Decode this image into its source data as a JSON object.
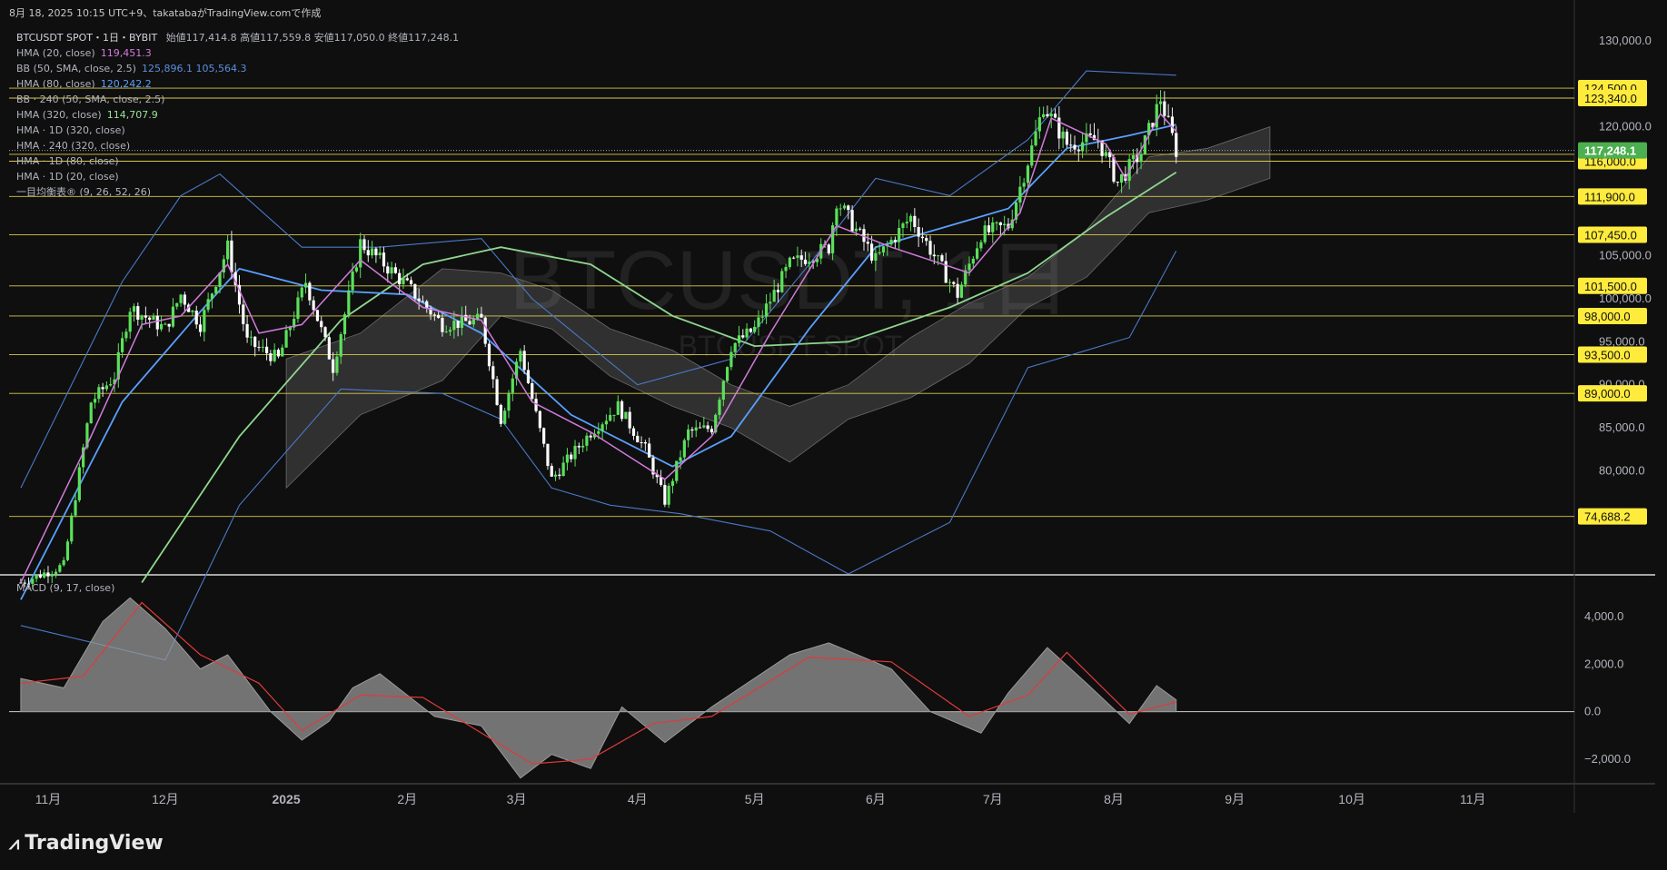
{
  "header": {
    "caption": "8月 18, 2025 10:15 UTC+9、takatabaがTradingView.comで作成",
    "symbol": "BTCUSDT SPOT・1日・BYBIT",
    "ohlc": "始値117,414.8 高値117,559.8 安値117,050.0 終値117,248.1"
  },
  "indicators": [
    {
      "label": "HMA (20, close)",
      "value": "119,451.3",
      "color": "#d17bdb"
    },
    {
      "label": "BB (50, SMA, close, 2.5)",
      "value": "125,896.1  105,564.3",
      "color": "#5b8fde"
    },
    {
      "label": "HMA (80, close)",
      "value": "120,242.2",
      "color": "#5aa0ff"
    },
    {
      "label": "BB · 240 (50, SMA, close, 2.5)",
      "value": "",
      "color": "#b2b5be"
    },
    {
      "label": "HMA (320, close)",
      "value": "114,707.9",
      "color": "#9be39b"
    },
    {
      "label": "HMA · 1D (320, close)",
      "value": "",
      "color": "#b2b5be"
    },
    {
      "label": "HMA · 240 (320, close)",
      "value": "",
      "color": "#b2b5be"
    },
    {
      "label": "HMA · 1D (80, close)",
      "value": "",
      "color": "#b2b5be"
    },
    {
      "label": "HMA · 1D (20, close)",
      "value": "",
      "color": "#b2b5be"
    },
    {
      "label": "一目均衡表® (9, 26, 52, 26)",
      "value": "",
      "color": "#b2b5be"
    }
  ],
  "watermark": {
    "big": "BTCUSDT, 1日",
    "small": "BTCUSDT SPOT"
  },
  "macd_label": "MACD (9, 17, close)",
  "brand": "TradingView",
  "chart_data": [
    {
      "type": "candlestick",
      "title": "BTCUSDT SPOT・1日・BYBIT",
      "ylim": [
        68000,
        132000
      ],
      "y_ticks": [
        "130,000.0",
        "120,000.0",
        "105,000.0",
        "100,000.0",
        "95,000.0",
        "90,000.0",
        "85,000.0",
        "80,000.0"
      ],
      "x_ticks": [
        "11月",
        "12月",
        "2025",
        "2月",
        "3月",
        "4月",
        "5月",
        "6月",
        "7月",
        "8月",
        "9月",
        "10月",
        "11月"
      ],
      "horizontal_levels": [
        124500,
        123340,
        116800,
        116000,
        111900,
        107450,
        101500,
        98000,
        93500,
        89000,
        74688.2
      ],
      "level_labels": [
        "124,500.0",
        "123,340.0",
        "116,800.0",
        "116,000.0",
        "111,900.0",
        "107,450.0",
        "101,500.0",
        "98,000.0",
        "93,500.0",
        "89,000.0",
        "74,688.2"
      ],
      "last_price": 117248.1,
      "last_price_label": "117,248.1",
      "price_path": [
        [
          "2024-10-25",
          67000
        ],
        [
          "2024-11-05",
          69000
        ],
        [
          "2024-11-12",
          88000
        ],
        [
          "2024-11-18",
          91000
        ],
        [
          "2024-11-22",
          99000
        ],
        [
          "2024-12-01",
          96500
        ],
        [
          "2024-12-05",
          100500
        ],
        [
          "2024-12-10",
          97000
        ],
        [
          "2024-12-17",
          106000
        ],
        [
          "2024-12-22",
          95000
        ],
        [
          "2024-12-30",
          93000
        ],
        [
          "2025-01-06",
          102000
        ],
        [
          "2025-01-13",
          92000
        ],
        [
          "2025-01-20",
          106500
        ],
        [
          "2025-01-25",
          104500
        ],
        [
          "2025-02-01",
          101500
        ],
        [
          "2025-02-10",
          97000
        ],
        [
          "2025-02-20",
          97500
        ],
        [
          "2025-02-25",
          86000
        ],
        [
          "2025-03-02",
          94000
        ],
        [
          "2025-03-10",
          79000
        ],
        [
          "2025-03-20",
          84500
        ],
        [
          "2025-03-27",
          87500
        ],
        [
          "2025-04-03",
          82500
        ],
        [
          "2025-04-08",
          76500
        ],
        [
          "2025-04-14",
          84500
        ],
        [
          "2025-04-20",
          85000
        ],
        [
          "2025-04-25",
          94500
        ],
        [
          "2025-05-01",
          96500
        ],
        [
          "2025-05-10",
          104000
        ],
        [
          "2025-05-20",
          106000
        ],
        [
          "2025-05-22",
          111500
        ],
        [
          "2025-06-01",
          104500
        ],
        [
          "2025-06-10",
          109500
        ],
        [
          "2025-06-22",
          100500
        ],
        [
          "2025-06-28",
          107500
        ],
        [
          "2025-07-05",
          108500
        ],
        [
          "2025-07-11",
          117500
        ],
        [
          "2025-07-14",
          122500
        ],
        [
          "2025-07-20",
          118000
        ],
        [
          "2025-07-28",
          118500
        ],
        [
          "2025-08-02",
          113500
        ],
        [
          "2025-08-08",
          117000
        ],
        [
          "2025-08-13",
          123300
        ],
        [
          "2025-08-17",
          117248.1
        ]
      ],
      "hma20": [
        [
          "2024-10-25",
          67000
        ],
        [
          "2024-11-12",
          84000
        ],
        [
          "2024-11-25",
          97000
        ],
        [
          "2024-12-05",
          98000
        ],
        [
          "2024-12-17",
          104000
        ],
        [
          "2024-12-25",
          96000
        ],
        [
          "2025-01-05",
          97000
        ],
        [
          "2025-01-20",
          104500
        ],
        [
          "2025-02-05",
          99000
        ],
        [
          "2025-02-20",
          97500
        ],
        [
          "2025-03-05",
          88000
        ],
        [
          "2025-03-20",
          84500
        ],
        [
          "2025-04-08",
          79000
        ],
        [
          "2025-04-20",
          84000
        ],
        [
          "2025-05-05",
          96000
        ],
        [
          "2025-05-22",
          108500
        ],
        [
          "2025-06-05",
          106000
        ],
        [
          "2025-06-25",
          103000
        ],
        [
          "2025-07-08",
          110000
        ],
        [
          "2025-07-16",
          121000
        ],
        [
          "2025-07-30",
          118000
        ],
        [
          "2025-08-04",
          114000
        ],
        [
          "2025-08-13",
          121500
        ],
        [
          "2025-08-17",
          119451.3
        ]
      ],
      "hma80": [
        [
          "2024-10-25",
          65000
        ],
        [
          "2024-11-20",
          88000
        ],
        [
          "2024-12-10",
          98500
        ],
        [
          "2024-12-20",
          103500
        ],
        [
          "2025-01-10",
          101000
        ],
        [
          "2025-02-01",
          100500
        ],
        [
          "2025-02-20",
          96000
        ],
        [
          "2025-03-15",
          86500
        ],
        [
          "2025-04-10",
          80500
        ],
        [
          "2025-04-25",
          84000
        ],
        [
          "2025-05-15",
          96500
        ],
        [
          "2025-06-01",
          106000
        ],
        [
          "2025-06-20",
          108500
        ],
        [
          "2025-07-05",
          110500
        ],
        [
          "2025-07-20",
          117500
        ],
        [
          "2025-08-05",
          119000
        ],
        [
          "2025-08-17",
          120242.2
        ]
      ],
      "hma320": [
        [
          "2024-11-25",
          67000
        ],
        [
          "2024-12-20",
          84000
        ],
        [
          "2025-01-15",
          97500
        ],
        [
          "2025-02-05",
          104000
        ],
        [
          "2025-02-25",
          106000
        ],
        [
          "2025-03-20",
          104000
        ],
        [
          "2025-04-10",
          98000
        ],
        [
          "2025-05-01",
          94500
        ],
        [
          "2025-05-25",
          95000
        ],
        [
          "2025-06-20",
          99000
        ],
        [
          "2025-07-10",
          103000
        ],
        [
          "2025-07-30",
          109500
        ],
        [
          "2025-08-17",
          114707.9
        ]
      ],
      "bb_upper": [
        [
          "2024-10-25",
          78000
        ],
        [
          "2024-11-20",
          102000
        ],
        [
          "2024-12-05",
          112000
        ],
        [
          "2024-12-15",
          114500
        ],
        [
          "2025-01-05",
          106000
        ],
        [
          "2025-01-25",
          106000
        ],
        [
          "2025-02-20",
          107000
        ],
        [
          "2025-03-05",
          100000
        ],
        [
          "2025-04-01",
          90000
        ],
        [
          "2025-04-25",
          93000
        ],
        [
          "2025-05-15",
          104000
        ],
        [
          "2025-06-01",
          114000
        ],
        [
          "2025-06-20",
          112000
        ],
        [
          "2025-07-10",
          118500
        ],
        [
          "2025-07-25",
          126500
        ],
        [
          "2025-08-17",
          126000
        ]
      ],
      "bb_lower": [
        [
          "2024-10-25",
          62000
        ],
        [
          "2024-12-01",
          58000
        ],
        [
          "2024-12-20",
          76000
        ],
        [
          "2025-01-15",
          89500
        ],
        [
          "2025-02-10",
          89000
        ],
        [
          "2025-02-25",
          86000
        ],
        [
          "2025-03-10",
          78000
        ],
        [
          "2025-03-25",
          76000
        ],
        [
          "2025-04-12",
          75000
        ],
        [
          "2025-05-05",
          73000
        ],
        [
          "2025-05-25",
          68000
        ],
        [
          "2025-06-20",
          74000
        ],
        [
          "2025-07-10",
          92000
        ],
        [
          "2025-07-25",
          94000
        ],
        [
          "2025-08-05",
          95500
        ],
        [
          "2025-08-17",
          105564.3
        ]
      ]
    },
    {
      "type": "area",
      "title": "MACD (9, 17, close)",
      "ylim": [
        -3000,
        5500
      ],
      "y_ticks": [
        "4,000.0",
        "2,000.0",
        "0.0",
        "−2,000.0"
      ],
      "histogram": [
        [
          "2024-10-25",
          1400
        ],
        [
          "2024-11-05",
          1000
        ],
        [
          "2024-11-15",
          3800
        ],
        [
          "2024-11-22",
          4800
        ],
        [
          "2024-12-01",
          3500
        ],
        [
          "2024-12-10",
          1800
        ],
        [
          "2024-12-17",
          2400
        ],
        [
          "2024-12-28",
          0
        ],
        [
          "2025-01-05",
          -1200
        ],
        [
          "2025-01-12",
          -400
        ],
        [
          "2025-01-18",
          1000
        ],
        [
          "2025-01-25",
          1600
        ],
        [
          "2025-02-08",
          -200
        ],
        [
          "2025-02-20",
          -600
        ],
        [
          "2025-03-02",
          -2800
        ],
        [
          "2025-03-10",
          -1800
        ],
        [
          "2025-03-20",
          -2400
        ],
        [
          "2025-03-28",
          200
        ],
        [
          "2025-04-08",
          -1300
        ],
        [
          "2025-04-20",
          200
        ],
        [
          "2025-05-10",
          2400
        ],
        [
          "2025-05-20",
          2900
        ],
        [
          "2025-06-05",
          1800
        ],
        [
          "2025-06-15",
          0
        ],
        [
          "2025-06-28",
          -900
        ],
        [
          "2025-07-05",
          800
        ],
        [
          "2025-07-15",
          2700
        ],
        [
          "2025-07-25",
          1200
        ],
        [
          "2025-08-05",
          -500
        ],
        [
          "2025-08-12",
          1100
        ],
        [
          "2025-08-17",
          500
        ]
      ],
      "signal": [
        [
          "2024-10-25",
          1200
        ],
        [
          "2024-11-10",
          1500
        ],
        [
          "2024-11-25",
          4600
        ],
        [
          "2024-12-10",
          2400
        ],
        [
          "2024-12-25",
          1200
        ],
        [
          "2025-01-05",
          -800
        ],
        [
          "2025-01-20",
          700
        ],
        [
          "2025-02-05",
          600
        ],
        [
          "2025-03-05",
          -2200
        ],
        [
          "2025-03-20",
          -2000
        ],
        [
          "2025-04-05",
          -500
        ],
        [
          "2025-04-20",
          -200
        ],
        [
          "2025-05-15",
          2300
        ],
        [
          "2025-06-05",
          2100
        ],
        [
          "2025-06-25",
          -200
        ],
        [
          "2025-07-10",
          700
        ],
        [
          "2025-07-20",
          2500
        ],
        [
          "2025-08-05",
          -100
        ],
        [
          "2025-08-17",
          400
        ]
      ]
    }
  ]
}
